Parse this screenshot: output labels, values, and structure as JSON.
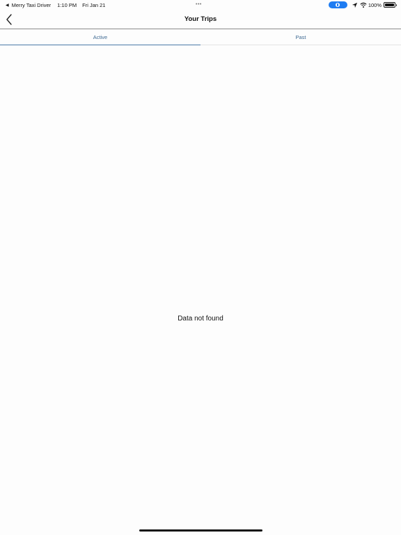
{
  "status_bar": {
    "back_glyph": "◀",
    "app_name": "Merry Taxi Driver",
    "time": "1:10 PM",
    "date": "Fri Jan 21",
    "multitask_dots": "•••",
    "battery_percent": "100%",
    "icons": [
      "location-arrow-icon",
      "wifi-icon",
      "battery-icon"
    ],
    "pill_color": "#1e7cf2"
  },
  "nav": {
    "title": "Your Trips"
  },
  "tabs": [
    {
      "label": "Active",
      "selected": true
    },
    {
      "label": "Past",
      "selected": false
    }
  ],
  "content": {
    "empty_message": "Data not found"
  },
  "colors": {
    "tab_text": "#3f6a93",
    "tab_indicator": "#4a7aa8"
  }
}
